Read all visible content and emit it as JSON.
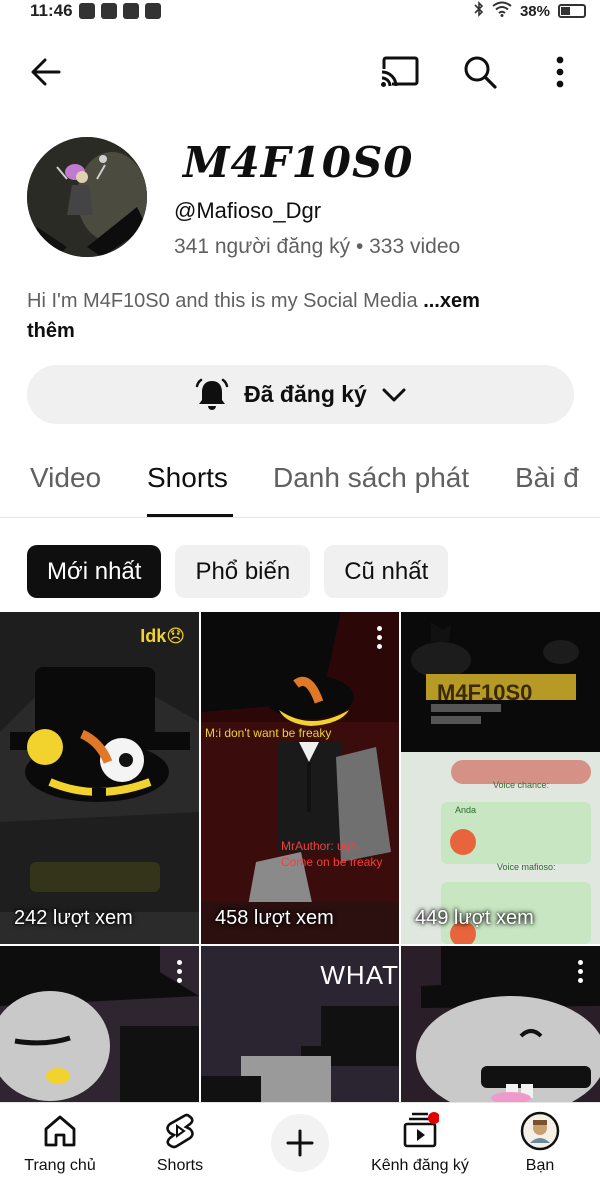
{
  "status_bar": {
    "time": "11:46",
    "battery": "38%"
  },
  "header": {
    "back_icon": "arrow-left-icon",
    "cast_icon": "cast-icon",
    "search_icon": "search-icon",
    "more_icon": "more-vertical-icon"
  },
  "channel": {
    "name": "M4F10S0",
    "handle": "@Mafioso_Dgr",
    "stats": "341 người đăng ký • 333 video",
    "description": "Hi I'm  M4F10S0 and this is my Social Media ",
    "more_label": "...xem",
    "more_label_line2": "thêm"
  },
  "subscribe": {
    "label": "Đã đăng ký",
    "bell_icon": "bell-ring-icon",
    "chevron_icon": "chevron-down-icon"
  },
  "tabs": [
    {
      "label": "Video"
    },
    {
      "label": "Shorts"
    },
    {
      "label": "Danh sách phát"
    },
    {
      "label": "Bài đ"
    }
  ],
  "active_tab": "Shorts",
  "chips": [
    {
      "label": "Mới nhất",
      "selected": true
    },
    {
      "label": "Phổ biến",
      "selected": false
    },
    {
      "label": "Cũ nhất",
      "selected": false
    }
  ],
  "shorts": [
    {
      "views": "242 lượt xem",
      "caption": "Idk😞"
    },
    {
      "views": "458 lượt xem",
      "caption": "M:i don't want be freaky"
    },
    {
      "views": "449 lượt xem",
      "caption": "M4F10S0"
    },
    {
      "views": "",
      "caption": ""
    },
    {
      "views": "",
      "caption": "WHAT"
    },
    {
      "views": "",
      "caption": ""
    }
  ],
  "thumb_text": {
    "caption2b": "MrAuthor: ugh.. Come on be freaky",
    "chat_voice_1": "Voice chance:",
    "chat_name": "Anda",
    "chat_voice_2": "Voice mafioso:"
  },
  "bottom_nav": [
    {
      "label": "Trang chủ",
      "icon": "home-icon"
    },
    {
      "label": "Shorts",
      "icon": "shorts-icon"
    },
    {
      "label": "",
      "icon": "plus-icon"
    },
    {
      "label": "Kênh đăng ký",
      "icon": "subscriptions-icon"
    },
    {
      "label": "Bạn",
      "icon": "profile-avatar-icon"
    }
  ],
  "colors": {
    "accent": "#0f0f0f",
    "secondary_text": "#606060",
    "chip_bg": "#f0f0f0",
    "notification_dot": "#e00000"
  }
}
